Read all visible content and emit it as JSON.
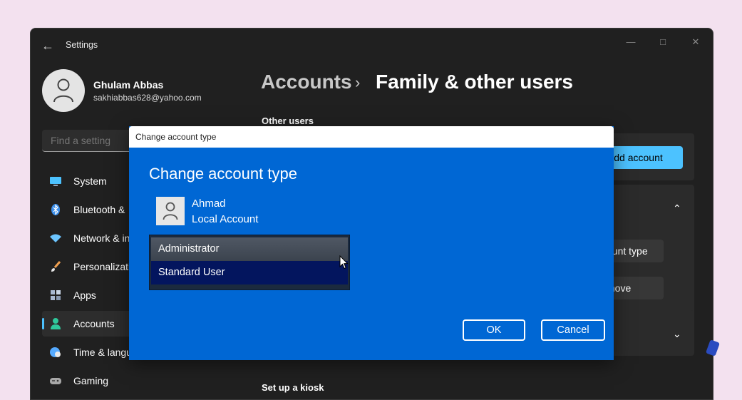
{
  "window": {
    "title": "Settings",
    "user": {
      "name": "Ghulam Abbas",
      "email": "sakhiabbas628@yahoo.com"
    },
    "search": {
      "placeholder": "Find a setting"
    }
  },
  "sidebar": {
    "items": [
      {
        "label": "System",
        "icon": "monitor-icon",
        "color": "#4cc2ff"
      },
      {
        "label": "Bluetooth &",
        "icon": "bluetooth-icon",
        "color": "#3b8eea"
      },
      {
        "label": "Network & in",
        "icon": "wifi-icon",
        "color": "#6cc5ff"
      },
      {
        "label": "Personalizatio",
        "icon": "brush-icon",
        "color": "#f0a050"
      },
      {
        "label": "Apps",
        "icon": "apps-icon",
        "color": "#a8b8d0"
      },
      {
        "label": "Accounts",
        "icon": "person-icon",
        "color": "#2fc79b",
        "active": true
      },
      {
        "label": "Time & langu",
        "icon": "globe-clock-icon",
        "color": "#55aaff"
      },
      {
        "label": "Gaming",
        "icon": "gamepad-icon",
        "color": "#a8a8a8"
      }
    ]
  },
  "main": {
    "breadcrumb": {
      "parent": "Accounts",
      "separator": "›",
      "current": "Family & other users"
    },
    "other_users_heading": "Other users",
    "add_account_label": "dd account",
    "change_type_label": "ount type",
    "remove_label": "move",
    "kiosk_heading": "Set up a kiosk"
  },
  "dialog": {
    "window_title": "Change account type",
    "heading": "Change account type",
    "account_name": "Ahmad",
    "account_kind": "Local Account",
    "options": [
      "Administrator",
      "Standard User"
    ],
    "selected_option": "Standard User",
    "ok_label": "OK",
    "cancel_label": "Cancel"
  },
  "colors": {
    "accent": "#4cc2ff",
    "dialog_bg": "#0067d4",
    "selected_option_bg": "#03155e"
  }
}
